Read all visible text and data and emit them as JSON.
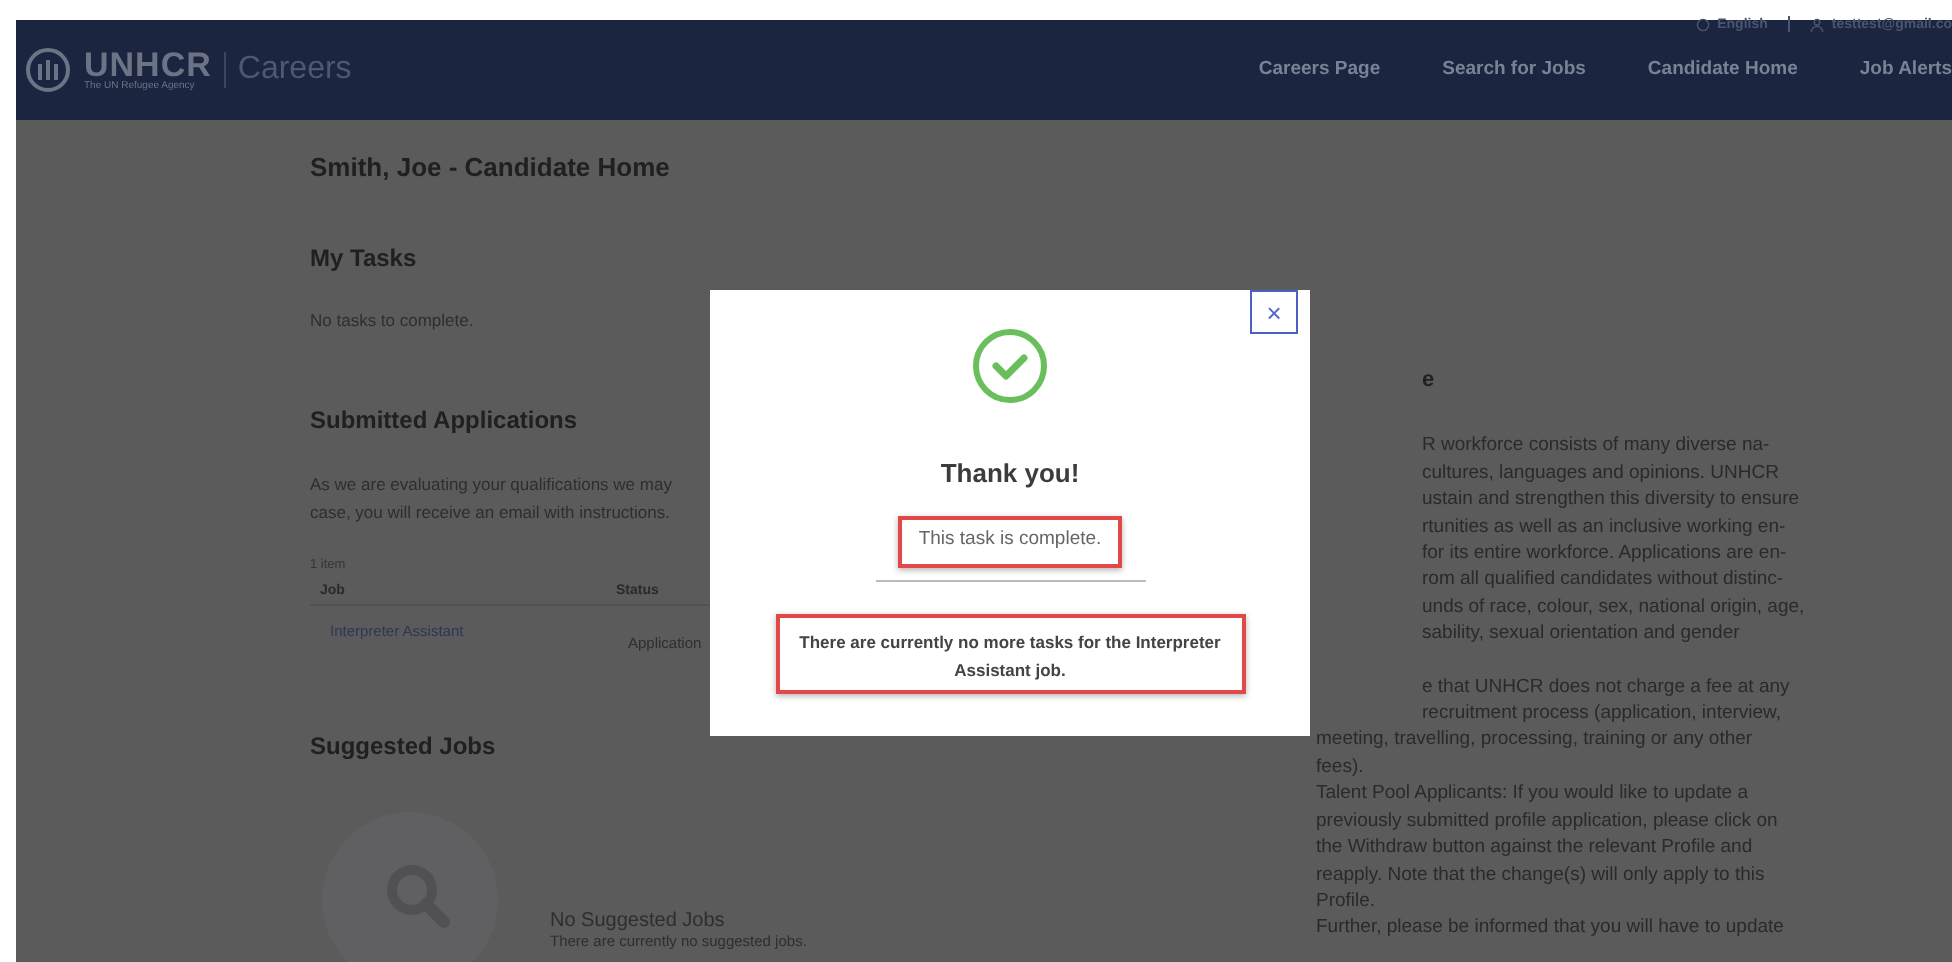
{
  "header": {
    "logo_name": "UNHCR",
    "logo_tagline": "The UN Refugee Agency",
    "app_name": "Careers",
    "language": "English",
    "user_email": "testtest@gmail.co",
    "nav": [
      "Careers Page",
      "Search for Jobs",
      "Candidate Home",
      "Job Alerts"
    ]
  },
  "page": {
    "title": "Smith, Joe - Candidate Home",
    "my_tasks": {
      "heading": "My Tasks",
      "empty_text": "No tasks to complete."
    },
    "submitted": {
      "heading": "Submitted Applications",
      "intro_lines": [
        "As we are evaluating your qualifications we may",
        "case, you will receive an email with instructions."
      ],
      "count": "1 item",
      "columns": [
        "Job",
        "Status"
      ],
      "rows": [
        {
          "job": "Interpreter Assistant",
          "status": "Application"
        }
      ]
    },
    "suggested": {
      "heading": "Suggested Jobs",
      "empty_title": "No Suggested Jobs",
      "empty_text": "There are currently no suggested jobs."
    },
    "side": {
      "heading": "e",
      "paragraphs": [
        [
          {
            "kind": "partial",
            "text": "R workforce consists of many diverse na-"
          },
          {
            "kind": "partial",
            "text": "cultures, languages and opinions. UNHCR"
          },
          {
            "kind": "partial",
            "text": "ustain and strengthen this diversity to ensure"
          },
          {
            "kind": "partial",
            "text": "rtunities as well as an inclusive working en-"
          },
          {
            "kind": "partial",
            "text": "for its entire workforce. Applications are en-"
          },
          {
            "kind": "partial",
            "text": "rom all qualified candidates without distinc-"
          },
          {
            "kind": "partial",
            "text": "unds of race, colour, sex, national origin, age,"
          },
          {
            "kind": "partial",
            "text": "sability, sexual orientation and gender"
          }
        ],
        [
          {
            "kind": "partial",
            "text": "e that UNHCR does not charge a fee at any"
          },
          {
            "kind": "partial",
            "text": "recruitment process (application, interview,"
          },
          {
            "kind": "full",
            "text": "meeting, travelling, processing, training or any other"
          },
          {
            "kind": "full",
            "text": "fees)."
          },
          {
            "kind": "full",
            "text": "Talent Pool Applicants: If you would like to update a"
          },
          {
            "kind": "full",
            "text": "previously submitted profile application, please click on"
          },
          {
            "kind": "full",
            "text": "the Withdraw button against the relevant Profile and"
          },
          {
            "kind": "full",
            "text": "reapply. Note that the change(s) will only apply to this"
          },
          {
            "kind": "full",
            "text": "Profile."
          },
          {
            "kind": "full",
            "text": "Further, please be informed that you will have to update"
          }
        ]
      ]
    }
  },
  "modal": {
    "close": "×",
    "title": "Thank you!",
    "message": "This task is complete.",
    "note": "There are currently no more tasks for the Interpreter Assistant job."
  }
}
